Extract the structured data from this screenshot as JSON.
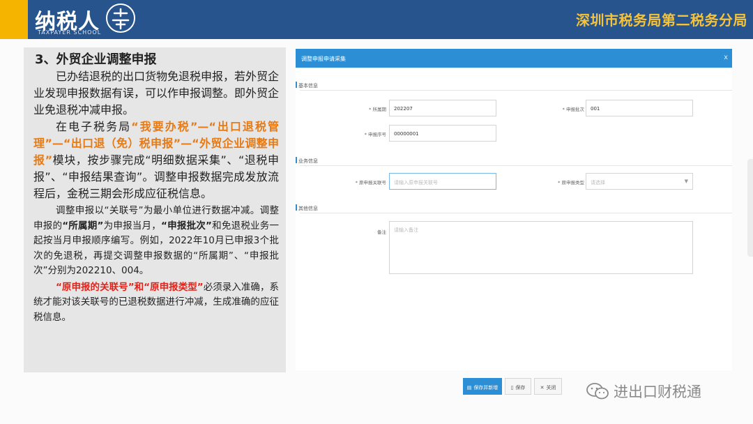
{
  "header": {
    "logo_text": "纳税人",
    "logo_sub": "TAXPAYER SCHOOL",
    "bureau": "深圳市税务局第二税务分局",
    "colors": {
      "banner": "#27548c",
      "accent": "#f5b400",
      "bureau_text": "#f5c23a"
    }
  },
  "article": {
    "heading": "3、外贸企业调整申报",
    "p1": "已办结退税的出口货物免退税申报，若外贸企业发现申报数据有误，可以作申报调整。即外贸企业免退税冲减申报。",
    "p2_a": "在电子税务局",
    "p2_path": "“我要办税”—“出口退税管理”—“出口退（免）税申报”—“外贸企业调整申报”",
    "p2_b": "模块，按步骤完成“明细数据采集”、“退税申报”、“申报结果查询”。调整申报数据完成发放流程后，金税三期会形成应征税信息。",
    "p3_a": "调整申报以“关联号”为最小单位进行数据冲减。调整申报的",
    "p3_term1": "“所属期”",
    "p3_b": "为申报当月，",
    "p3_term2": "“申报批次”",
    "p3_c": "和免退税业务一起按当月申报顺序编写。例如，2022年10月已申报3个批次的免退税，再提交调整申报数据的“所属期”、“申报批次”分别为202210、004。",
    "p4_red": "“原申报的关联号”和“原申报类型”",
    "p4_rest": "必须录入准确，系统才能对该关联号的已退税数据进行冲减，生成准确的应征税信息。"
  },
  "dialog": {
    "title": "调整申报申请采集",
    "close": "x",
    "sections": {
      "basic": "基本信息",
      "business": "业务信息",
      "other": "其他信息"
    },
    "fields": {
      "period_label": "* 所属期",
      "period_value": "202207",
      "batch_label": "* 申报批次",
      "batch_value": "001",
      "seq_label": "* 申报序号",
      "seq_value": "00000001",
      "orig_link_label": "* 原申报关联号",
      "orig_link_placeholder": "请输入原申报关联号",
      "orig_type_label": "* 原申报类型",
      "orig_type_placeholder": "请选择",
      "remark_label": "备注",
      "remark_placeholder": "请输入备注"
    },
    "buttons": {
      "save": "保存并新增",
      "keep": "保存",
      "close": "关闭"
    }
  },
  "watermark": {
    "text": "进出口财税通"
  }
}
